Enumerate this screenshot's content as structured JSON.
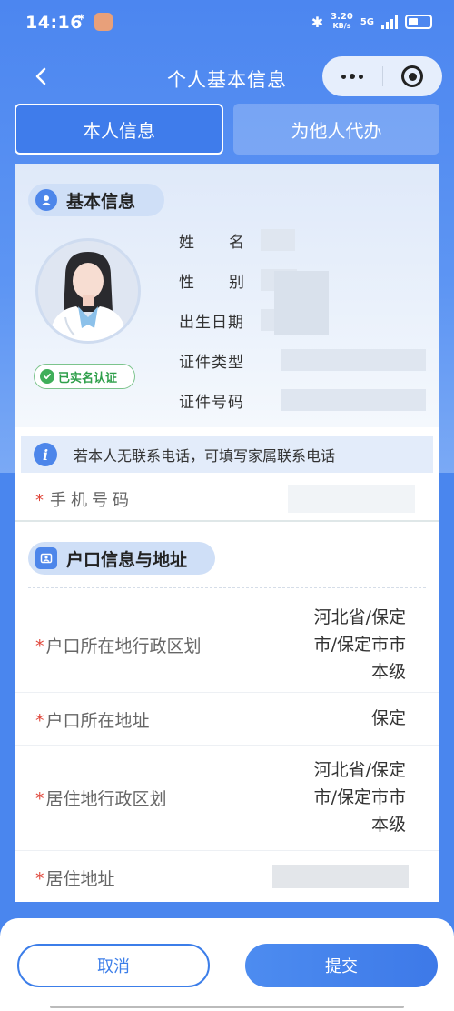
{
  "status": {
    "time": "14:16",
    "misc": "*",
    "speed_value": "3.20",
    "speed_unit": "KB/s",
    "network": "5G"
  },
  "nav": {
    "title": "个人基本信息"
  },
  "tabs": {
    "self_label": "本人信息",
    "other_label": "为他人代办"
  },
  "basic_info": {
    "header": "基本信息",
    "verified_label": "已实名认证",
    "fields": [
      {
        "label": "姓名"
      },
      {
        "label": "性别"
      },
      {
        "label": "出生日期"
      },
      {
        "label": "证件类型"
      },
      {
        "label": "证件号码"
      }
    ]
  },
  "notice": {
    "icon_char": "i",
    "text": "若本人无联系电话，可填写家属联系电话"
  },
  "phone": {
    "required_mark": "*",
    "label": "手机号码"
  },
  "huko": {
    "header": "户口信息与地址",
    "rows": [
      {
        "label": "户口所在地行政区划",
        "value": "河北省/保定市/保定市市本级"
      },
      {
        "label": "户口所在地址",
        "value": "保定"
      },
      {
        "label": "居住地行政区划",
        "value": "河北省/保定市/保定市市本级"
      },
      {
        "label": "居住地址",
        "value": ""
      }
    ]
  },
  "actions": {
    "cancel_label": "取消",
    "submit_label": "提交"
  },
  "colors": {
    "primary": "#4a86ee",
    "required": "#e0463a",
    "verified": "#3fae5a"
  }
}
